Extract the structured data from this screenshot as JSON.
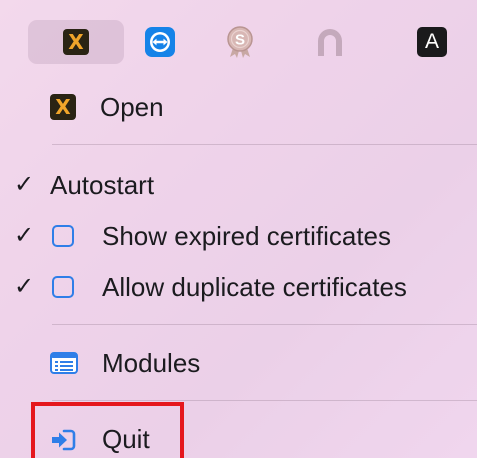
{
  "menubar": {
    "items": [
      {
        "icon": "xca-icon",
        "glyph": "X",
        "active": true
      },
      {
        "icon": "teamviewer-icon"
      },
      {
        "icon": "certificate-seal-icon",
        "glyph": "S"
      },
      {
        "icon": "arch-icon"
      },
      {
        "icon": "input-source-icon",
        "glyph": "A"
      }
    ]
  },
  "menu": {
    "open": {
      "label": "Open",
      "icon": "xca-icon",
      "glyph": "X"
    },
    "autostart": {
      "label": "Autostart",
      "checked": true
    },
    "show_expired": {
      "label": "Show expired certificates",
      "checked": true
    },
    "allow_duplicate": {
      "label": "Allow duplicate certificates",
      "checked": true
    },
    "modules": {
      "label": "Modules",
      "icon": "list-window-icon"
    },
    "quit": {
      "label": "Quit",
      "icon": "exit-arrow-icon",
      "highlighted": true
    }
  },
  "colors": {
    "accent": "#2f7ee8",
    "highlight_border": "#e5171d",
    "xca_orange": "#f0a52a",
    "teamviewer_blue": "#1583e8"
  },
  "check_glyph": "✓"
}
